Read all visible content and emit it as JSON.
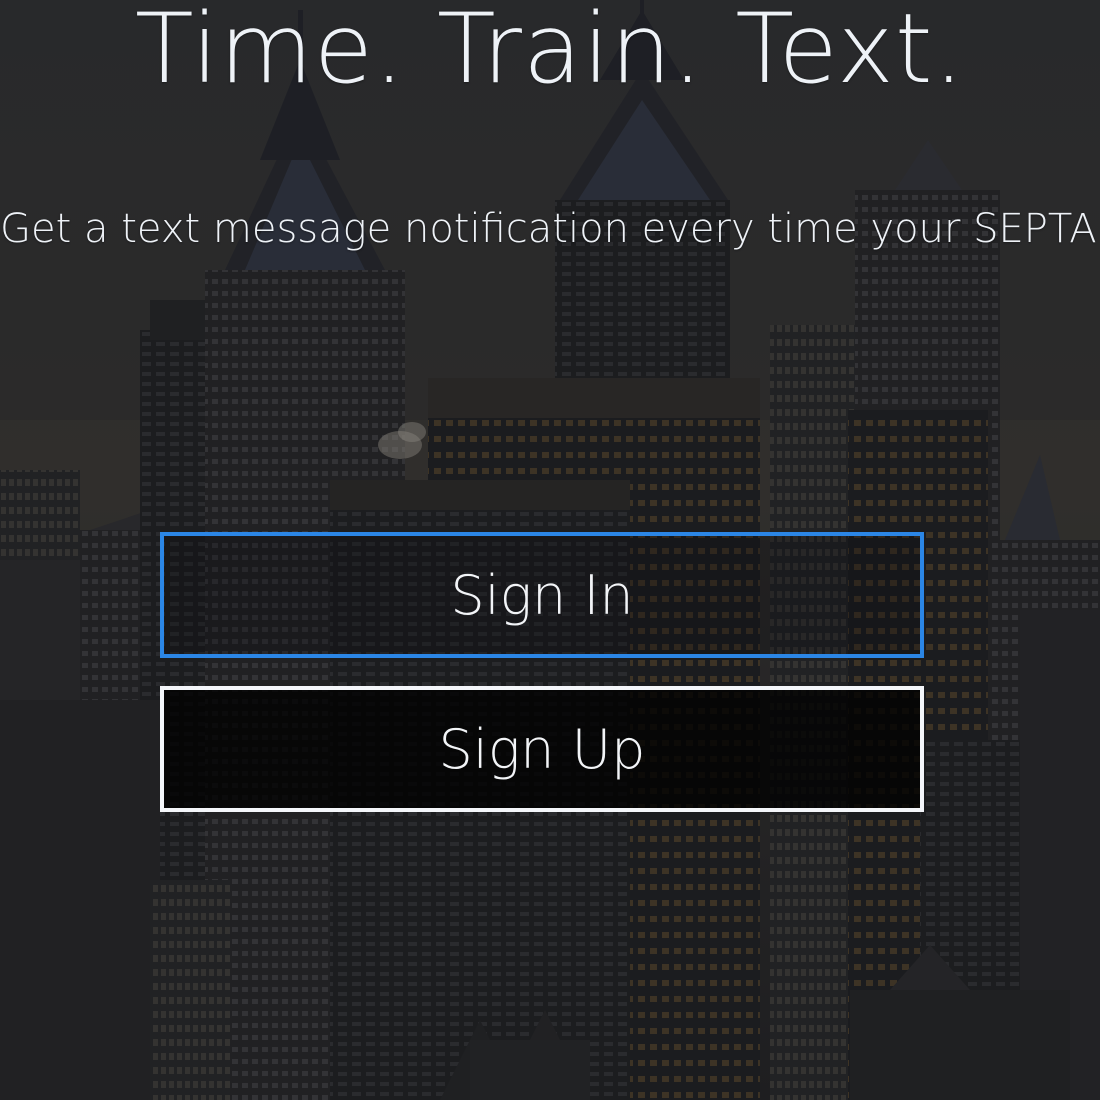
{
  "hero": {
    "title": "Time. Train. Text.",
    "subtitle": "Get a text message notification every time your SEPTA Regional Rail train is late."
  },
  "actions": {
    "sign_in_label": "Sign In",
    "sign_up_label": "Sign Up"
  },
  "colors": {
    "sign_in_border": "#2b86e6",
    "sign_up_border": "#f4f6fa",
    "text": "#eef2f7"
  },
  "icons": []
}
